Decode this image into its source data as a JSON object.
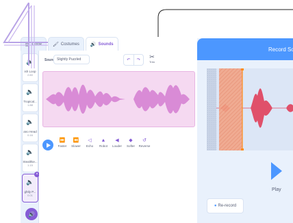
{
  "step_number": "4",
  "tabs": [
    {
      "icon": "code-icon",
      "label": "Code"
    },
    {
      "icon": "costumes-icon",
      "label": "Costumes"
    },
    {
      "icon": "sounds-icon",
      "label": "Sounds"
    }
  ],
  "sound_list": [
    {
      "name": "ish Loop",
      "duration": "2.60"
    },
    {
      "name": "Tropical...",
      "duration": "1.88"
    },
    {
      "name": "ano Head",
      "duration": "0.16"
    },
    {
      "name": "Stealthie...",
      "duration": "1.15"
    },
    {
      "name": "ghtly P...",
      "duration": "0.01"
    }
  ],
  "editor": {
    "sound_label": "Sound",
    "sound_name": "Slightly Puzzled",
    "trim_label": "Trim",
    "effects": [
      {
        "icon": "faster-icon",
        "label": "Faster"
      },
      {
        "icon": "slower-icon",
        "label": "Slower"
      },
      {
        "icon": "echo-icon",
        "label": "Echo"
      },
      {
        "icon": "robot-icon",
        "label": "Robot"
      },
      {
        "icon": "louder-icon",
        "label": "Louder"
      },
      {
        "icon": "softer-icon",
        "label": "Softer"
      },
      {
        "icon": "reverse-icon",
        "label": "Reverse"
      }
    ]
  },
  "record_panel": {
    "title": "Record So",
    "play_label": "Play",
    "rerecord_label": "Re-record"
  },
  "colors": {
    "accent": "#855cd6",
    "blue": "#4c97ff",
    "waveform": "#d98bd6",
    "trim_handle": "#ff8c1a"
  }
}
